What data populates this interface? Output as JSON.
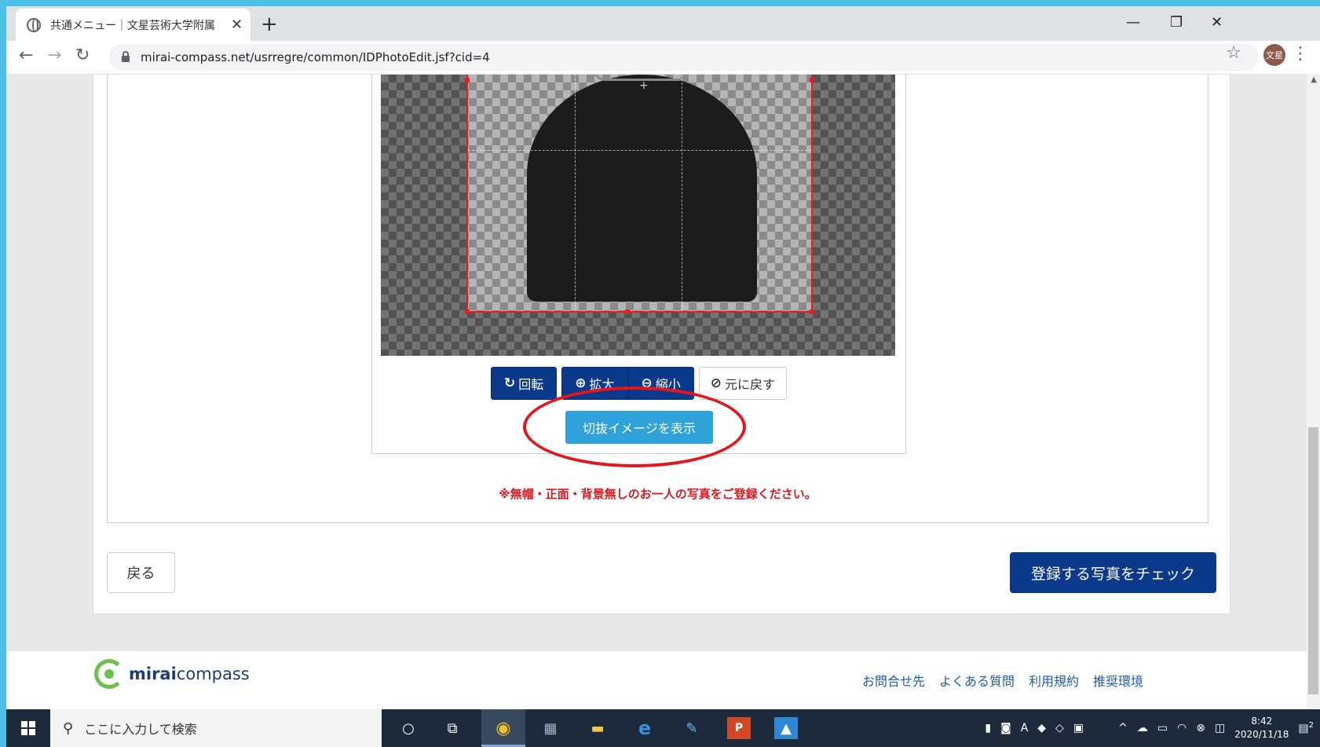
{
  "browser": {
    "tab_title": "共通メニュー｜文星芸術大学附属",
    "url": "mirai-compass.net/usrregre/common/IDPhotoEdit.jsf?cid=4",
    "profile_label": "文星"
  },
  "editor": {
    "buttons": {
      "rotate": "回転",
      "zoom_in": "拡大",
      "zoom_out": "縮小",
      "reset": "元に戻す"
    },
    "preview_button": "切抜イメージを表示",
    "notice": "※無帽・正面・背景無しのお一人の写真をご登録ください。"
  },
  "actions": {
    "back": "戻る",
    "check": "登録する写真をチェック"
  },
  "footer": {
    "logo_bold": "mirai",
    "logo_rest": "compass",
    "links": [
      "お問合せ先",
      "よくある質問",
      "利用規約",
      "推奨環境"
    ]
  },
  "taskbar": {
    "search_placeholder": "ここに入力して検索",
    "time": "8:42",
    "date": "2020/11/18",
    "notification_count": "2"
  },
  "colors": {
    "primary": "#0b3a8c",
    "preview_button": "#2fa3d9",
    "annotation": "#e4151b",
    "notice": "#e4151b"
  }
}
